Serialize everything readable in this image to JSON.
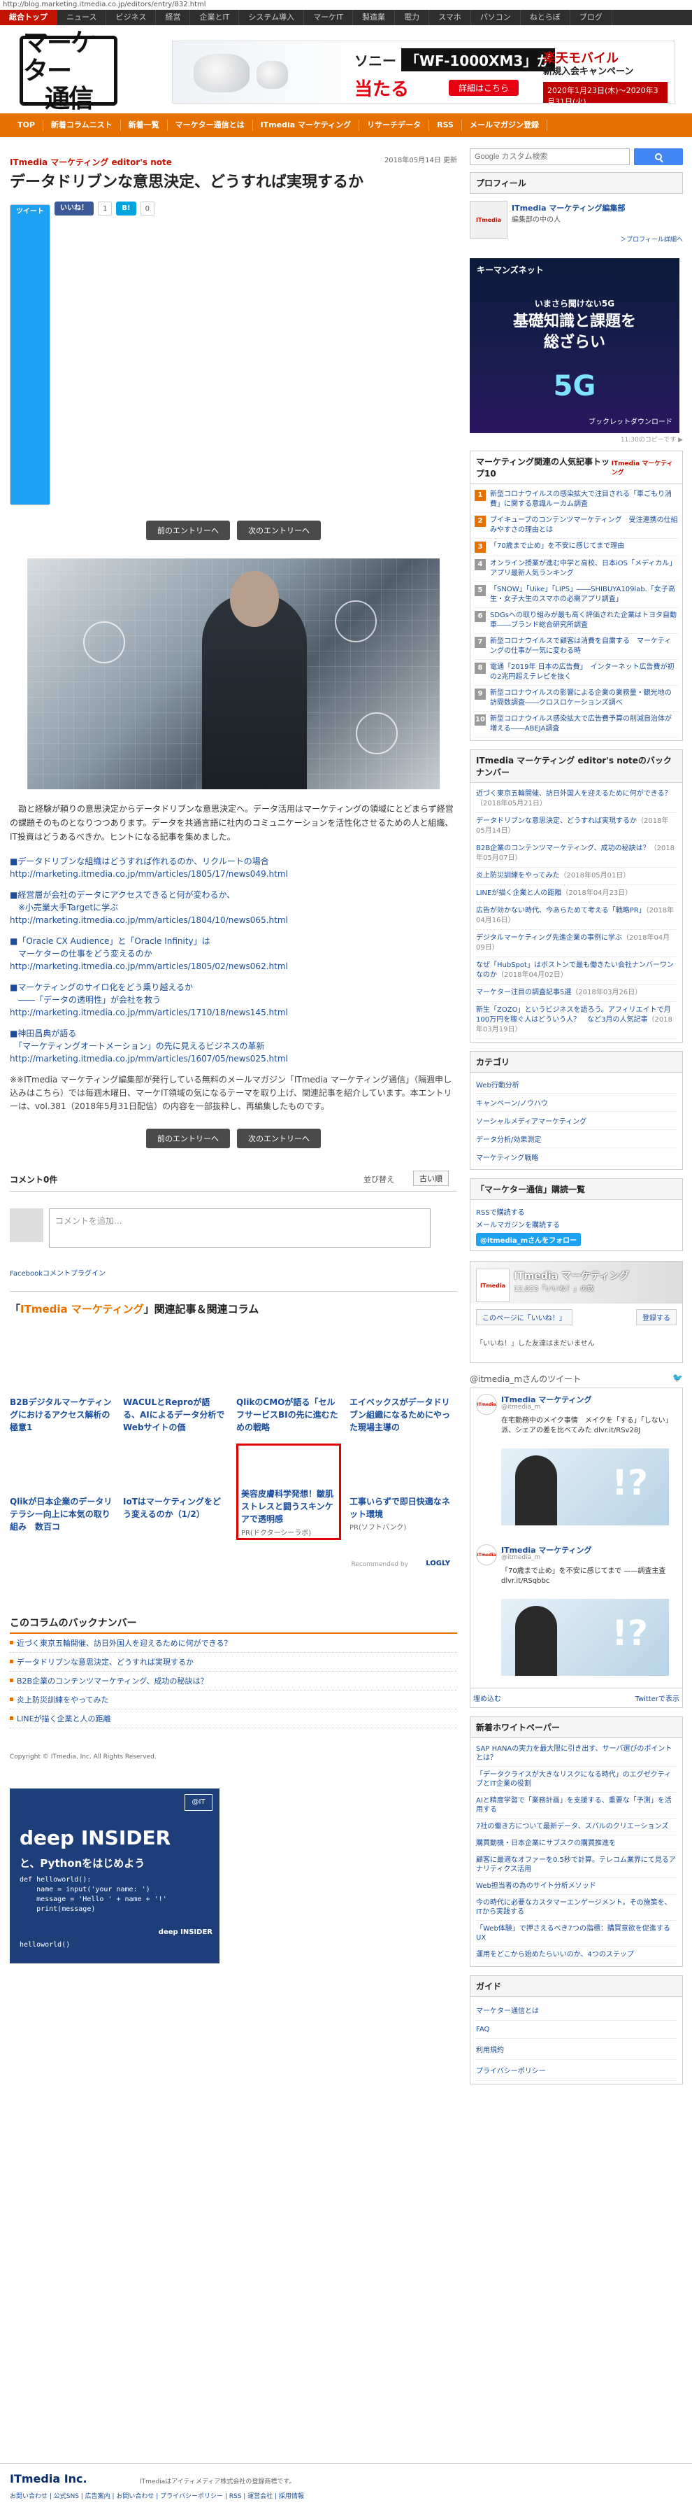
{
  "url": "http://blog.marketing.itmedia.co.jp/editors/entry/832.html",
  "top_nav": [
    "総合トップ",
    "ニュース",
    "ビジネス",
    "経営",
    "企業とIT",
    "システム導入",
    "マーケIT",
    "製造業",
    "電力",
    "スマホ",
    "パソコン",
    "ねとらぼ",
    "ブログ"
  ],
  "logo_text_1": "マーケター",
  "logo_text_2": "通信",
  "banner": {
    "sony": "ソニー",
    "product": "「WF-1000XM3」が",
    "win": "当たる",
    "detail": "詳細はこちら",
    "rakuten": "楽天モバイル",
    "campaign": "新規入会キャンペーン",
    "period": "2020年1月23日(木)〜2020年3月31日(火)"
  },
  "cat_nav": [
    "TOP",
    "新着コラムニスト",
    "新着一覧",
    "マーケター通信とは",
    "ITmedia マーケティング",
    "リサーチデータ",
    "RSS",
    "メールマガジン登録"
  ],
  "search": {
    "placeholder": "Google カスタム検索"
  },
  "article": {
    "date": "2018年05月14日 更新",
    "series": "ITmedia マーケティング editor's note",
    "title": "データドリブンな意思決定、どうすれば実現するか",
    "tweet": "ツイート",
    "like": "いいね！",
    "like_count": "1",
    "hatena_count": "0",
    "prev": "前のエントリーへ",
    "next": "次のエントリーへ",
    "lead": "勘と経験が頼りの意思決定からデータドリブンな意思決定へ。データ活用はマーケティングの領域にとどまらず経営の課題そのものとなりつつあります。データを共通言語に社内のコミュニケーションを活性化させるための人と組織、IT投資はどうあるべきか。ヒントになる記事を集めました。",
    "links": [
      {
        "t": "■データドリブンな組織はどうすれば作れるのか、リクルートの場合",
        "u": "http://marketing.itmedia.co.jp/mm/articles/1805/17/news049.html"
      },
      {
        "t": "■経営層が会社のデータにアクセスできると何が変わるか、",
        "t2": "　※小売業大手Targetに学ぶ",
        "u": "http://marketing.itmedia.co.jp/mm/articles/1804/10/news065.html"
      },
      {
        "t": "■「Oracle CX Audience」と「Oracle Infinity」は",
        "t2": "　マーケターの仕事をどう変えるのか",
        "u": "http://marketing.itmedia.co.jp/mm/articles/1805/02/news062.html"
      },
      {
        "t": "■マーケティングのサイロ化をどう乗り越えるか",
        "t2": "　――「データの透明性」が会社を救う",
        "u": "http://marketing.itmedia.co.jp/mm/articles/1710/18/news145.html"
      },
      {
        "t": "■神田昌典が語る",
        "t2": "　「マーケティングオートメーション」の先に見えるビジネスの革新",
        "u": "http://marketing.itmedia.co.jp/mm/articles/1607/05/news025.html"
      }
    ],
    "note": "※※ITmedia マーケティング編集部が発行している無料のメールマガジン「ITmedia マーケティング通信」（隔週申し込みはこちら）では毎週木曜日、マーケIT領域の気になるテーマを取り上げ、関連記事を紹介しています。本エントリーは、vol.381（2018年5月31日配信）の内容を一部抜粋し、再編集したものです。"
  },
  "comments": {
    "count": "コメント0件",
    "sort_label": "並び替え",
    "sort_value": "古い順",
    "placeholder": "コメントを追加...",
    "plugin": "Facebookコメントプラグイン"
  },
  "related": {
    "head_prefix": "「",
    "head_brand": "ITmedia マーケティング",
    "head_suffix": "」関連記事＆関連コラム",
    "items": [
      {
        "t": "B2Bデジタルマーケティングにおけるアクセス解析の極意1"
      },
      {
        "t": "WACULとReproが語る、AIによるデータ分析でWebサイトの価"
      },
      {
        "t": "QlikのCMOが語る「セルフサービスBIの先に進むための戦略"
      },
      {
        "t": "エイベックスがデータドリブン組織になるためにやった現場主導の"
      },
      {
        "t": "Qlikが日本企業のデータリテラシー向上に本気の取り組み　数百コ"
      },
      {
        "t": "IoTはマーケティングをどう変えるのか（1/2）"
      },
      {
        "t": "美容皮膚科学発想！皺肌ストレスと闘うスキンケアで透明感",
        "pr": "PR(ドクターシーラボ)"
      },
      {
        "t": "工事いらずで即日快適なネット環境",
        "pr": "PR(ソフトバンク)"
      }
    ],
    "recommended": "Recommended by",
    "logly": "LOGLY"
  },
  "backnumber": {
    "head": "このコラムのバックナンバー",
    "items": [
      "近づく東京五輪開催、訪日外国人を迎えるために何ができる？",
      "データドリブンな意思決定、どうすれば実現するか",
      "B2B企業のコンテンツマーケティング、成功の秘訣は？",
      "炎上防災訓練をやってみた",
      "LINEが描く企業と人の距離"
    ]
  },
  "copyright": "Copyright © ITmedia, Inc. All Rights Reserved.",
  "deep_ad": {
    "brand": "@IT",
    "logo": "deep INSIDER",
    "py": "と、Pythonをはじめよう",
    "code": "def helloworld():\n    name = input('your name: ')\n    message = 'Hello ' + name + '!'\n    print(message)",
    "hw": "helloworld()",
    "mini": "deep INSIDER"
  },
  "sidebar": {
    "profile_head": "プロフィール",
    "profile_name": "ITmedia マーケティング編集部",
    "profile_desc": "編集部の中の人",
    "profile_more": "＞プロフィール詳細へ",
    "kim": {
      "brand": "キーマンズネット",
      "sub": "いまさら聞けない5G",
      "main": "基礎知識と課題を\n総ざらい",
      "fg": "5G",
      "dl": "ブックレットダウンロード"
    },
    "kim_cap": "11:30のコピーです ▶",
    "ranking_head": "マーケティング関連の人気記事トップ10",
    "ranking_logo": "ITmedia マーケティング",
    "ranking": [
      "新型コロナウイルスの感染拡大で注目される「車ごもり消費」に関する意識ルーカム調査",
      "ブイキューブのコンテンツマーケティング　受注連携の仕組みやすさの理由とは",
      "「70歳まで止め」を不安に感じてまで理由",
      "オンライン授業が進む中学と高校、日本iOS「メディカル」アプリ最新人気ランキング",
      "「SNOW」「Uike」「LIPS」――SHIBUYA109lab.「女子高生・女子大生のスマホの必需アプリ調査」",
      "SDGsへの取り組みが最も高く評価された企業はトヨタ自動車――ブランド総合研究所調査",
      "新型コロナウイルスで顧客は消費を自粛する　マーケティングの仕事が一気に変わる時",
      "電通「2019年 日本の広告費」　インターネット広告費が初の2兆円超えテレビを抜く",
      "新型コロナウイルスの影響による企業の業務量・観光地の訪問数調査――クロスロケーションズ調べ",
      "新型コロナウイルス感染拡大で広告費予算の削減自治体が増える――ABEJA調査"
    ],
    "bn_head": "ITmedia マーケティング editor's noteのバックナンバー",
    "bn": [
      {
        "t": "近づく東京五輪開催、訪日外国人を迎えるために何ができる？",
        "d": "（2018年05月21日）"
      },
      {
        "t": "データドリブンな意思決定、どうすれば実現するか",
        "d": "（2018年05月14日）"
      },
      {
        "t": "B2B企業のコンテンツマーケティング、成功の秘訣は？",
        "d": "（2018年05月07日）"
      },
      {
        "t": "炎上防災訓練をやってみた",
        "d": "（2018年05月01日）"
      },
      {
        "t": "LINEが描く企業と人の距離",
        "d": "（2018年04月23日）"
      },
      {
        "t": "広告が効かない時代、今あらためて考える「戦略PR」",
        "d": "（2018年04月16日）"
      },
      {
        "t": "デジタルマーケティング先進企業の事例に学ぶ",
        "d": "（2018年04月09日）"
      },
      {
        "t": "なぜ「HubSpot」はボストンで最も働きたい会社ナンバーワンなのか",
        "d": "（2018年04月02日）"
      },
      {
        "t": "マーケター注目の調査記事5選",
        "d": "（2018年03月26日）"
      },
      {
        "t": "新生「ZOZO」というビジネスを語ろう。アフィリエイトで月100万円を稼ぐ人はどういう人？　など3月の人気記事",
        "d": "（2018年03月19日）"
      }
    ],
    "cat_head": "カテゴリ",
    "cats": [
      "Web行動分析",
      "キャンペーン/ノウハウ",
      "ソーシャルメディアマーケティング",
      "データ分析/効果測定",
      "マーケティング戦略"
    ],
    "rss_head": "「マーケター通信」購読一覧",
    "rss_items": [
      "RSSで購読する",
      "メールマガジンを購読する"
    ],
    "twitter_follow": "@itmedia_mさんをフォロー",
    "fb_name": "ITmedia マーケティング",
    "fb_likes": "12,023「いいね！」の数",
    "fb_like": "このページに「いいね！」",
    "fb_share": "登録する",
    "fb_none": "「いいね！」した友達はまだいません",
    "tw_head": "@itmedia_mさんのツイート",
    "tweets": [
      {
        "name": "ITmedia マーケティング",
        "handle": "@itmedia_m",
        "text": "在宅勤務中のメイク事情　メイクを「する」「しない」派、シェアの差を比べてみた dlvr.it/RSv28J"
      },
      {
        "name": "ITmedia マーケティング",
        "handle": "@itmedia_m",
        "text": "「70歳まで止め」を不安に感じてまで ——調査主査 dlvr.it/RSqbbc"
      }
    ],
    "tw_embed": "埋め込む",
    "tw_view": "Twitterで表示",
    "wp_head": "新着ホワイトペーパー",
    "wp": [
      "SAP HANAの実力を最大限に引き出す、サーバ選びのポイントとは？",
      "「データクライスが大きなリスクになる時代」のエグゼクティブとIT企業の役割",
      "AIと精度学習で「業務計画」を支援する、重要な「予測」を活用する",
      "7社の働き方について最新データ、スパルのクリエーションズ",
      "購買動機・日本企業にサブスクの購買推進を",
      "顧客に最適なオファーを0.5秒で計算。テレコム業界にて見るアナリティクス活用",
      "Web担当者の為のサイト分析メソッド",
      "今の時代に必要なカスタマーエンゲージメント。その施策を、ITから実践する",
      "「Web体験」で押さえるべき7つの指標：購買意欲を促進するUX",
      "運用をどこから始めたらいいのか、4つのステップ"
    ],
    "guide_head": "ガイド",
    "guide": [
      "マーケター通信とは",
      "FAQ",
      "利用規約",
      "プライバシーポリシー"
    ]
  },
  "footer": {
    "logo": "ITmedia Inc.",
    "copy": "ITmediaはアイティメディア株式会社の登録商標です。",
    "links": "お問い合わせ | 公式SNS | 広告案内 | お問い合わせ | プライバシーポリシー | RSS | 運営会社 | 採用情報"
  }
}
